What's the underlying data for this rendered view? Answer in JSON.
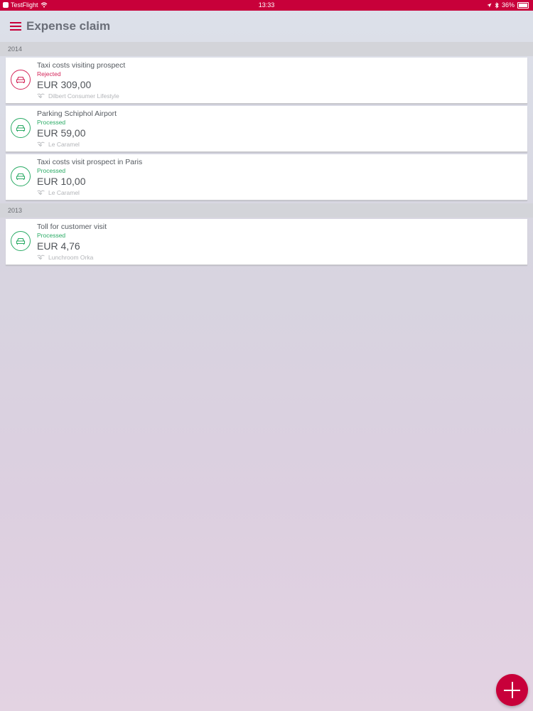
{
  "statusbar": {
    "carrier": "TestFlight",
    "time": "13:33",
    "battery": "36%"
  },
  "header": {
    "title": "Expense claim"
  },
  "colors": {
    "accent": "#c8003a",
    "processed": "#2bab66",
    "rejected": "#d4265a"
  },
  "sections": [
    {
      "year": "2014",
      "claims": [
        {
          "name": "Taxi costs visiting prospect",
          "status": "Rejected",
          "amount": "EUR 309,00",
          "client": "Dilbert Consumer Lifestyle",
          "icon": "car-icon"
        },
        {
          "name": "Parking Schiphol Airport",
          "status": "Processed",
          "amount": "EUR 59,00",
          "client": "Le Caramel",
          "icon": "car-icon"
        },
        {
          "name": "Taxi costs visit prospect in Paris",
          "status": "Processed",
          "amount": "EUR 10,00",
          "client": "Le Caramel",
          "icon": "car-icon"
        }
      ]
    },
    {
      "year": "2013",
      "claims": [
        {
          "name": "Toll for customer visit",
          "status": "Processed",
          "amount": "EUR 4,76",
          "client": "Lunchroom Orka",
          "icon": "car-icon"
        }
      ]
    }
  ]
}
